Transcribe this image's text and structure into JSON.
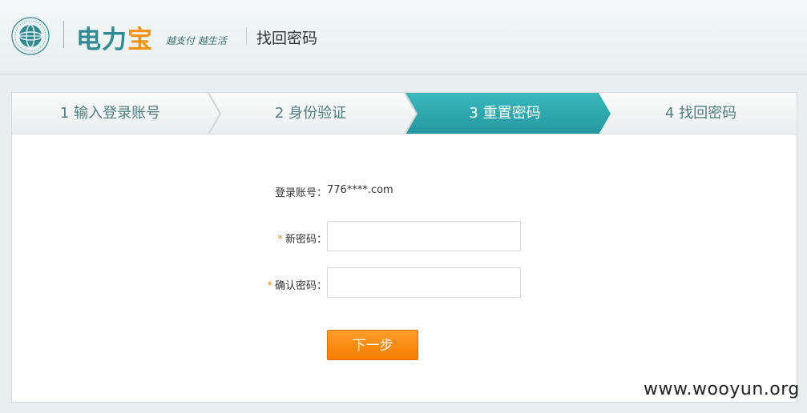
{
  "header": {
    "brand_main": "电力",
    "brand_accent": "宝",
    "slogan": "越支付 越生活",
    "page_title": "找回密码"
  },
  "steps": [
    {
      "label": "1 输入登录账号",
      "active": false
    },
    {
      "label": "2 身份验证",
      "active": false
    },
    {
      "label": "3 重置密码",
      "active": true
    },
    {
      "label": "4 找回密码",
      "active": false
    }
  ],
  "form": {
    "account_label": "登录账号：",
    "account_value": "776****.com",
    "new_password_label": "新密码：",
    "confirm_password_label": "确认密码：",
    "required_mark": "*",
    "next_button": "下一步"
  },
  "watermark": "www.wooyun.org",
  "colors": {
    "active_step": "#2aa2a8",
    "inactive_step": "#f2f4f4",
    "accent_orange": "#f57c00",
    "brand_teal": "#2f8a92"
  }
}
